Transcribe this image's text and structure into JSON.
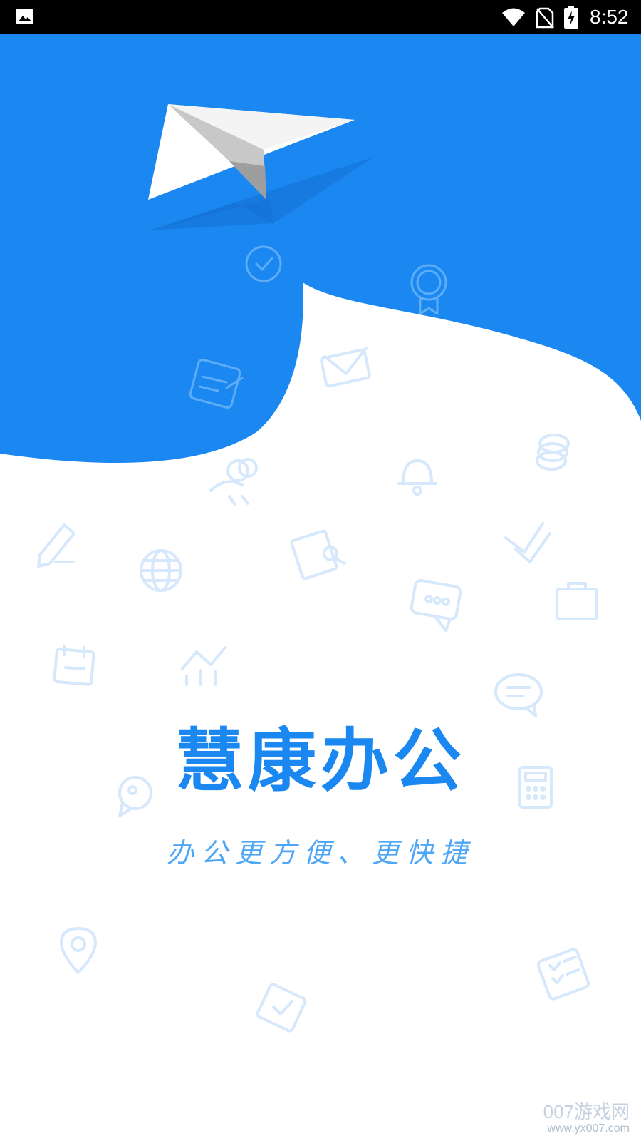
{
  "status_bar": {
    "time": "8:52",
    "icons": [
      "gallery-icon",
      "wifi-icon",
      "no-sim-icon",
      "battery-charging-icon"
    ]
  },
  "splash": {
    "app_name": "慧康办公",
    "slogan": "办公更方便、更快捷",
    "decorative_icons": [
      "paper-plane-icon",
      "clock-icon",
      "badge-icon",
      "notepad-icon",
      "envelope-icon",
      "coins-icon",
      "bell-icon",
      "team-icon",
      "pencil-icon",
      "document-search-icon",
      "checkmark-icon",
      "globe-icon",
      "chat-bubble-icon",
      "briefcase-icon",
      "calendar-icon",
      "chart-icon",
      "message-icon",
      "calculator-icon",
      "contact-icon",
      "location-icon",
      "calendar-check-icon",
      "checklist-icon"
    ]
  },
  "colors": {
    "brand_blue": "#1a88f0",
    "slogan_blue": "#4ea6f6",
    "icon_tint": "#d6e8fb"
  },
  "watermark": {
    "main": "007游戏网",
    "url": "www.yx007.com"
  }
}
